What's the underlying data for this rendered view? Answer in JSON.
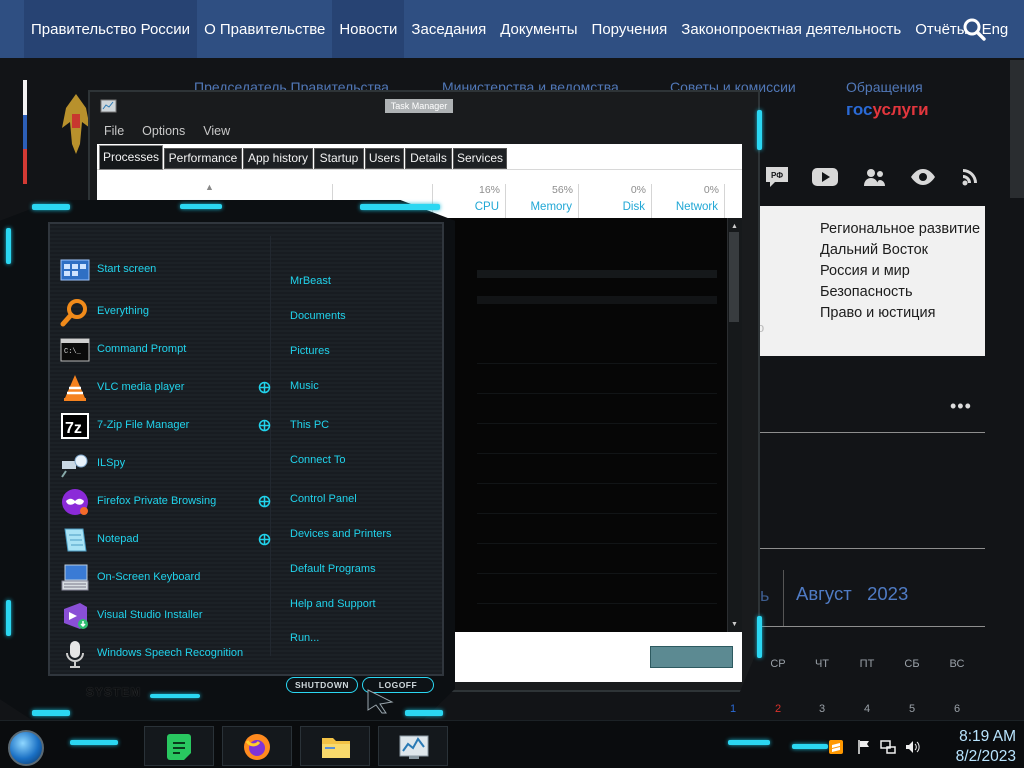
{
  "site": {
    "nav": [
      "Правительство России",
      "О Правительстве",
      "Новости",
      "Заседания",
      "Документы",
      "Поручения",
      "Законопроектная деятельность",
      "Отчёты",
      "Eng"
    ],
    "subnav": [
      "Председатель Правительства",
      "Министерства и ведомства",
      "Советы и комиссии",
      "Обращения"
    ],
    "gosuslugi": {
      "gos": "гос",
      "uslugi": "услуги"
    },
    "regions": [
      "Региональное развитие",
      "Дальний Восток",
      "Россия и мир",
      "Безопасность",
      "Право и юстиция"
    ],
    "bleed_text": "о",
    "more": "•••",
    "calendar": {
      "bleed": "ь",
      "month": "Август",
      "year": "2023",
      "weekdays": [
        "СР",
        "ЧТ",
        "ПТ",
        "СБ",
        "ВС"
      ],
      "days": [
        "1",
        "2",
        "3",
        "4",
        "5",
        "6"
      ],
      "highlight_color": "#d9322b"
    },
    "colors": {
      "nav_bg": "#2f4f82",
      "link": "#5178b8",
      "gos_blue": "#2a6ad6",
      "gos_red": "#e2363d"
    }
  },
  "task_manager": {
    "title": "Task Manager",
    "menu": [
      "File",
      "Options",
      "View"
    ],
    "tabs": [
      "Processes",
      "Performance",
      "App history",
      "Startup",
      "Users",
      "Details",
      "Services"
    ],
    "columns": [
      {
        "pct": "16%",
        "label": "CPU"
      },
      {
        "pct": "56%",
        "label": "Memory"
      },
      {
        "pct": "0%",
        "label": "Disk"
      },
      {
        "pct": "0%",
        "label": "Network"
      }
    ],
    "sort_arrow": "▲",
    "scroll_up": "▲",
    "scroll_down": "▼"
  },
  "start_menu": {
    "programs": [
      {
        "label": "Start screen",
        "icon": "start-screen-icon"
      },
      {
        "label": "Everything",
        "icon": "everything-search-icon"
      },
      {
        "label": "Command Prompt",
        "icon": "command-prompt-icon",
        "icon_text": "C:\\_"
      },
      {
        "label": "VLC media player",
        "icon": "vlc-icon",
        "submenu": true
      },
      {
        "label": "7-Zip File Manager",
        "icon": "7zip-icon",
        "icon_text": "7z",
        "submenu": true
      },
      {
        "label": "ILSpy",
        "icon": "ilspy-icon"
      },
      {
        "label": "Firefox Private Browsing",
        "icon": "firefox-private-icon",
        "submenu": true
      },
      {
        "label": "Notepad",
        "icon": "notepad-icon",
        "submenu": true
      },
      {
        "label": "On-Screen Keyboard",
        "icon": "onscreen-keyboard-icon"
      },
      {
        "label": "Visual Studio Installer",
        "icon": "visual-studio-installer-icon"
      },
      {
        "label": "Windows Speech Recognition",
        "icon": "microphone-icon"
      }
    ],
    "places": [
      "MrBeast",
      "Documents",
      "Pictures",
      "Music",
      "This PC",
      "Connect To",
      "Control Panel",
      "Devices and Printers",
      "Default Programs",
      "Help and Support",
      "Run..."
    ],
    "system_label": "SYSTEM",
    "shutdown": "SHUTDOWN",
    "logoff": "LOGOFF",
    "accent": "#21d3ec"
  },
  "taskbar": {
    "time": "8:19 AM",
    "date": "8/2/2023",
    "pinned": [
      "notes-app-icon",
      "firefox-icon",
      "file-explorer-icon",
      "task-manager-icon"
    ]
  }
}
